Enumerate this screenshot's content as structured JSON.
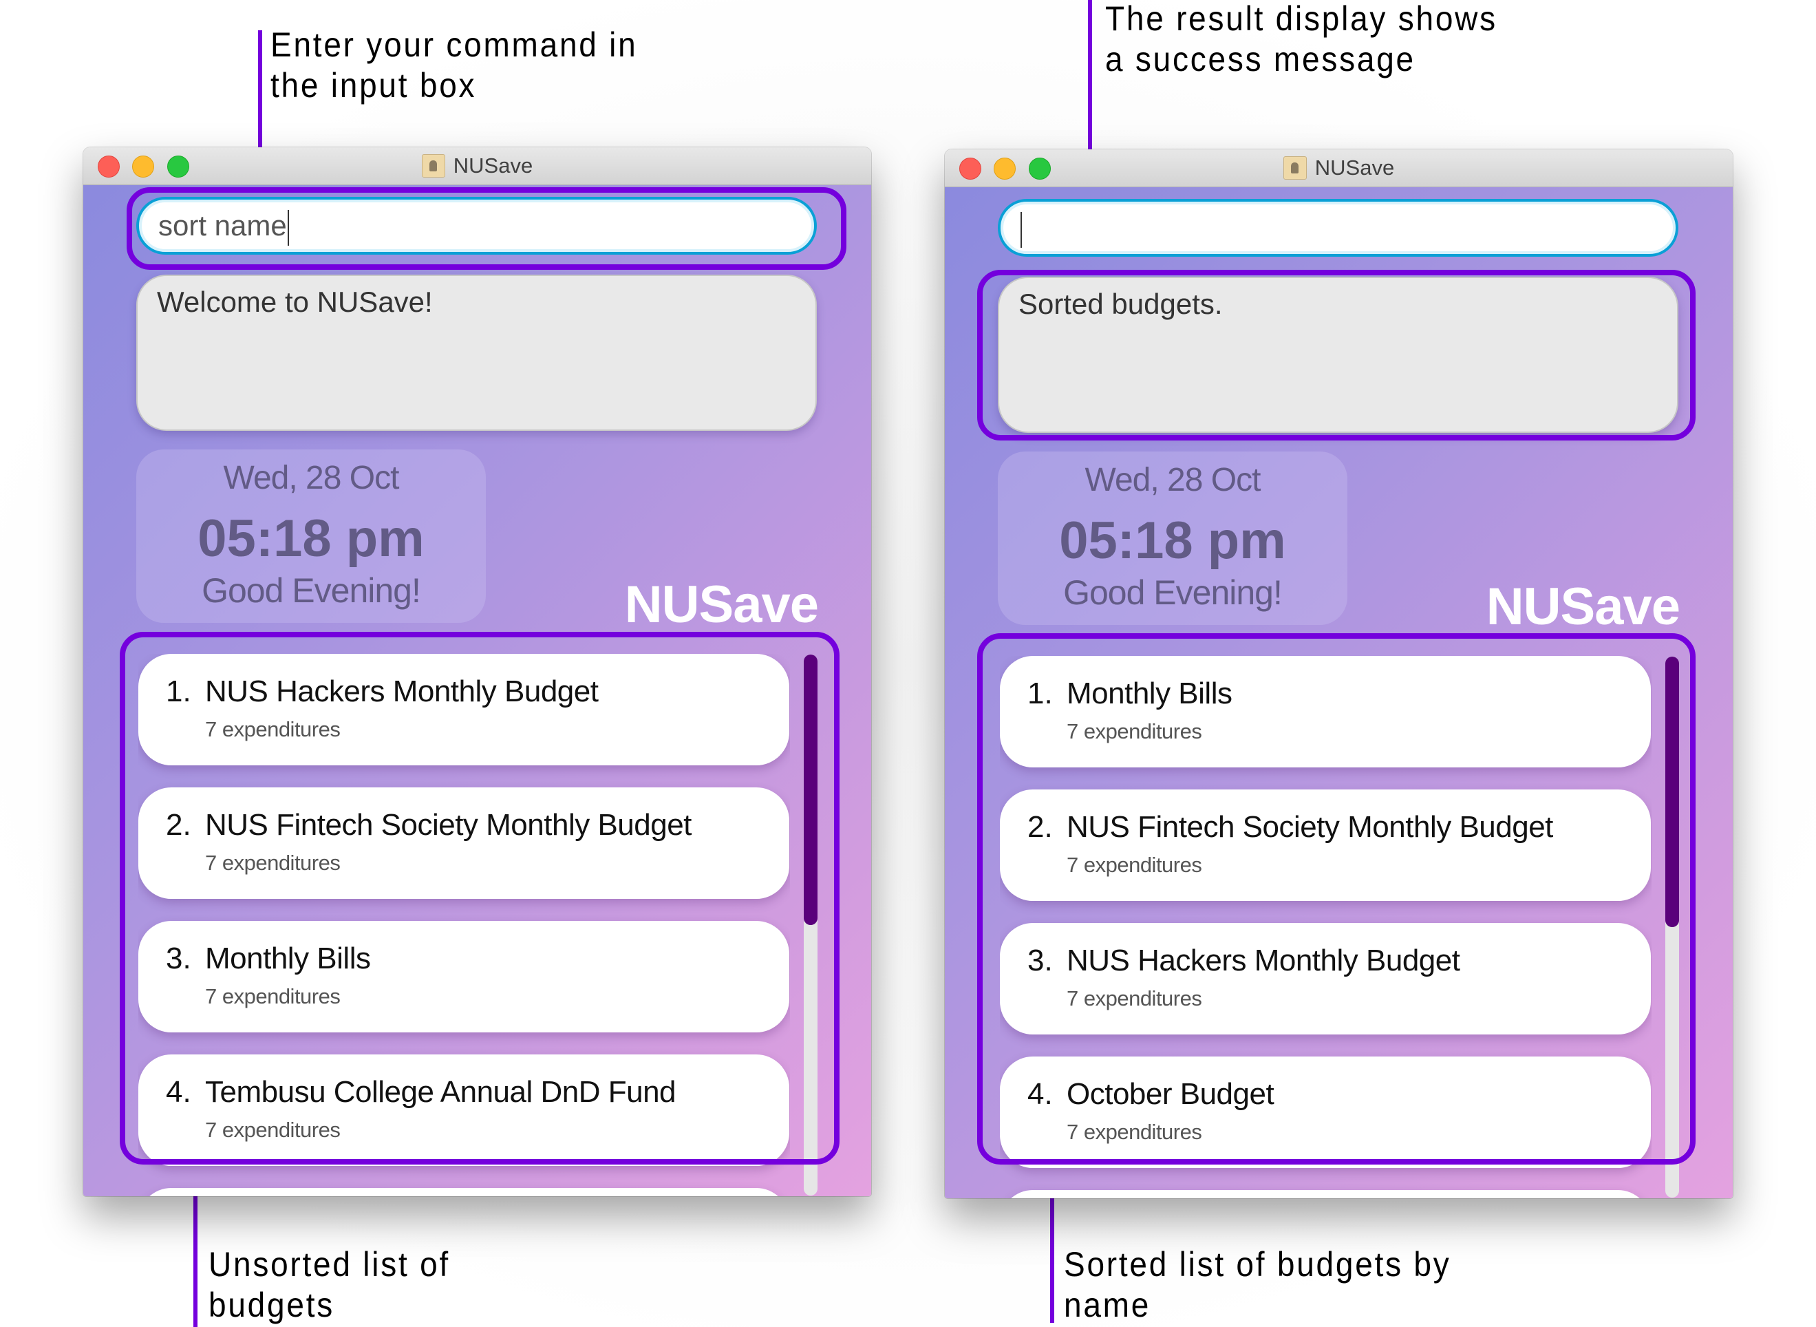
{
  "annotations": {
    "input": "Enter your command in\nthe input box",
    "result": "The result display shows\na success message",
    "unsorted": "Unsorted list of\nbudgets",
    "sorted": "Sorted list of budgets by\nname"
  },
  "colors": {
    "highlight": "#7400dd",
    "scroll_thumb": "#5a007b",
    "input_border": "#0aa0d6"
  },
  "windows": [
    {
      "title": "NUSave",
      "command_input": "sort name",
      "result_text": "Welcome to NUSave!",
      "clock": {
        "date": "Wed, 28 Oct",
        "time": "05:18 pm",
        "greeting": "Good Evening!"
      },
      "brand": "NUSave",
      "scroll_fraction_visible": 0.5,
      "budgets": [
        {
          "index": "1.",
          "name": "NUS Hackers Monthly Budget",
          "sub": "7 expenditures"
        },
        {
          "index": "2.",
          "name": "NUS Fintech Society Monthly Budget",
          "sub": "7 expenditures"
        },
        {
          "index": "3.",
          "name": "Monthly Bills",
          "sub": "7 expenditures"
        },
        {
          "index": "4.",
          "name": "Tembusu College Annual DnD Fund",
          "sub": "7 expenditures"
        }
      ]
    },
    {
      "title": "NUSave",
      "command_input": "",
      "result_text": "Sorted budgets.",
      "clock": {
        "date": "Wed, 28 Oct",
        "time": "05:18 pm",
        "greeting": "Good Evening!"
      },
      "brand": "NUSave",
      "scroll_fraction_visible": 0.5,
      "budgets": [
        {
          "index": "1.",
          "name": "Monthly Bills",
          "sub": "7 expenditures"
        },
        {
          "index": "2.",
          "name": "NUS Fintech Society Monthly Budget",
          "sub": "7 expenditures"
        },
        {
          "index": "3.",
          "name": "NUS Hackers Monthly Budget",
          "sub": "7 expenditures"
        },
        {
          "index": "4.",
          "name": "October Budget",
          "sub": "7 expenditures"
        }
      ]
    }
  ]
}
